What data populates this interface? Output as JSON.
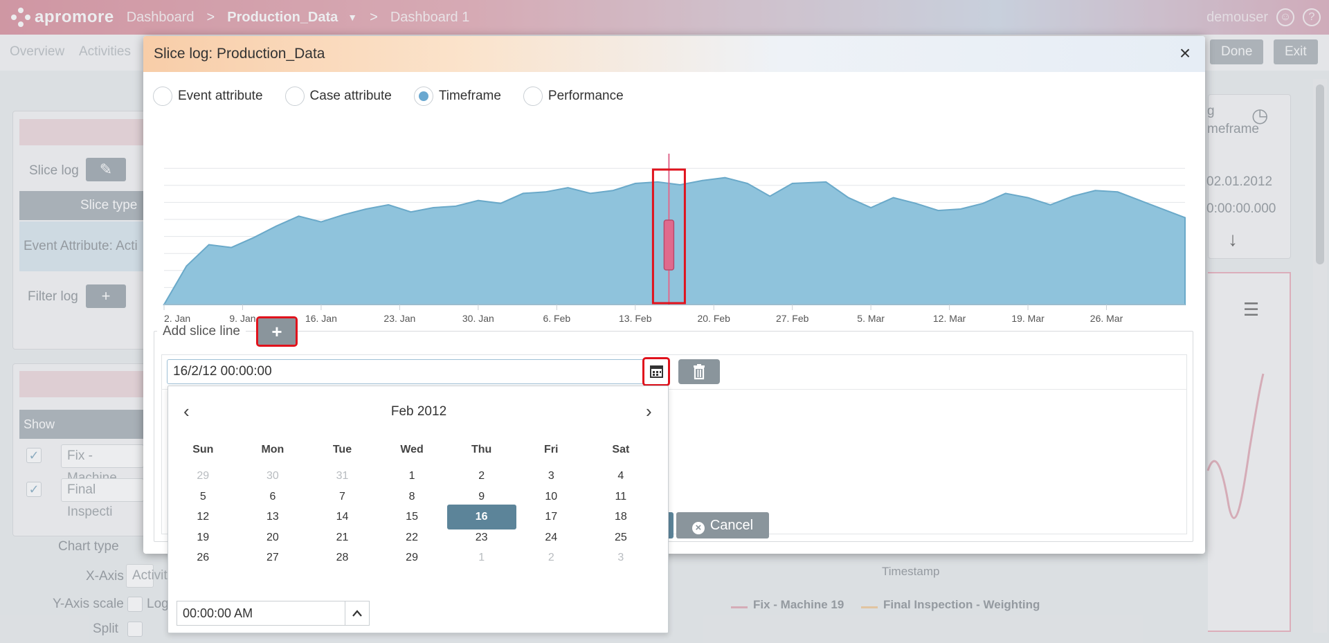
{
  "app": {
    "logo_text": "apromore",
    "breadcrumb": [
      "Dashboard",
      "Production_Data",
      "Dashboard 1"
    ],
    "separator": ">",
    "user": "demouser"
  },
  "background": {
    "tabs": [
      "Overview",
      "Activities"
    ],
    "buttons": {
      "done": "Done",
      "exit": "Exit"
    },
    "left_labels": {
      "slice_log": "Slice log",
      "slice_type": "Slice type",
      "event_attribute": "Event Attribute: Acti",
      "filter_log": "Filter log",
      "show": "Show",
      "row1": "Fix - Machine",
      "row2": "Final Inspecti",
      "chart_type": "Chart type",
      "x_axis": "X-Axis",
      "x_axis_value": "Activit",
      "y_axis_scale": "Y-Axis scale",
      "y_axis_log": "Log",
      "split": "Split"
    },
    "right_labels": {
      "g": "g",
      "timeframe": "meframe",
      "date": "02.01.2012",
      "time": "0:00:00.000",
      "timestamp": "Timestamp",
      "legend1": "Fix - Machine 19",
      "legend2": "Final Inspection - Weighting"
    }
  },
  "modal": {
    "title": "Slice log: Production_Data",
    "radios": [
      {
        "label": "Event attribute",
        "checked": false
      },
      {
        "label": "Case attribute",
        "checked": false
      },
      {
        "label": "Timeframe",
        "checked": true
      },
      {
        "label": "Performance",
        "checked": false
      }
    ],
    "add_slice_line": "Add slice line",
    "date_value": "16/2/12 00:00:00",
    "cancel_label": "Cancel",
    "colors": {
      "area_fill": "#8fc3dc",
      "area_stroke": "#6aa9c9",
      "slice_line": "#e06a8d",
      "highlight": "#e0121c"
    }
  },
  "chart_data": {
    "type": "area",
    "x_tick_labels": [
      "2. Jan",
      "9. Jan",
      "16. Jan",
      "23. Jan",
      "30. Jan",
      "6. Feb",
      "13. Feb",
      "20. Feb",
      "27. Feb",
      "5. Mar",
      "12. Mar",
      "19. Mar",
      "26. Mar"
    ],
    "xlim": [
      "2012-01-02",
      "2012-04-02"
    ],
    "x": [
      "2012-01-02",
      "2012-01-04",
      "2012-01-06",
      "2012-01-08",
      "2012-01-10",
      "2012-01-12",
      "2012-01-14",
      "2012-01-16",
      "2012-01-18",
      "2012-01-20",
      "2012-01-22",
      "2012-01-24",
      "2012-01-26",
      "2012-01-28",
      "2012-01-30",
      "2012-02-01",
      "2012-02-03",
      "2012-02-05",
      "2012-02-07",
      "2012-02-09",
      "2012-02-11",
      "2012-02-13",
      "2012-02-15",
      "2012-02-17",
      "2012-02-19",
      "2012-02-21",
      "2012-02-23",
      "2012-02-25",
      "2012-02-27",
      "2012-03-01",
      "2012-03-03",
      "2012-03-05",
      "2012-03-07",
      "2012-03-09",
      "2012-03-11",
      "2012-03-13",
      "2012-03-15",
      "2012-03-17",
      "2012-03-19",
      "2012-03-21",
      "2012-03-23",
      "2012-03-25",
      "2012-03-27",
      "2012-03-29",
      "2012-04-02"
    ],
    "values": [
      0,
      27,
      42,
      40,
      47,
      55,
      62,
      58,
      63,
      67,
      70,
      65,
      68,
      69,
      73,
      71,
      78,
      79,
      82,
      78,
      80,
      85,
      86,
      84,
      87,
      89,
      85,
      76,
      85,
      86,
      75,
      68,
      75,
      71,
      66,
      67,
      71,
      78,
      75,
      70,
      76,
      80,
      79,
      73,
      61
    ],
    "ylim": [
      0,
      100
    ],
    "grid": true,
    "slice_line": "2012-02-16"
  },
  "calendar": {
    "title": "Feb 2012",
    "prev": "‹",
    "next": "›",
    "weekdays": [
      "Sun",
      "Mon",
      "Tue",
      "Wed",
      "Thu",
      "Fri",
      "Sat"
    ],
    "weeks": [
      [
        {
          "d": "29",
          "m": true
        },
        {
          "d": "30",
          "m": true
        },
        {
          "d": "31",
          "m": true
        },
        {
          "d": "1"
        },
        {
          "d": "2"
        },
        {
          "d": "3"
        },
        {
          "d": "4"
        }
      ],
      [
        {
          "d": "5"
        },
        {
          "d": "6"
        },
        {
          "d": "7"
        },
        {
          "d": "8"
        },
        {
          "d": "9"
        },
        {
          "d": "10"
        },
        {
          "d": "11"
        }
      ],
      [
        {
          "d": "12"
        },
        {
          "d": "13"
        },
        {
          "d": "14"
        },
        {
          "d": "15"
        },
        {
          "d": "16",
          "s": true
        },
        {
          "d": "17"
        },
        {
          "d": "18"
        }
      ],
      [
        {
          "d": "19"
        },
        {
          "d": "20"
        },
        {
          "d": "21"
        },
        {
          "d": "22"
        },
        {
          "d": "23"
        },
        {
          "d": "24"
        },
        {
          "d": "25"
        }
      ],
      [
        {
          "d": "26"
        },
        {
          "d": "27"
        },
        {
          "d": "28"
        },
        {
          "d": "29"
        },
        {
          "d": "1",
          "m": true
        },
        {
          "d": "2",
          "m": true
        },
        {
          "d": "3",
          "m": true
        }
      ]
    ],
    "time_value": "00:00:00 AM",
    "time_spin": "^"
  }
}
